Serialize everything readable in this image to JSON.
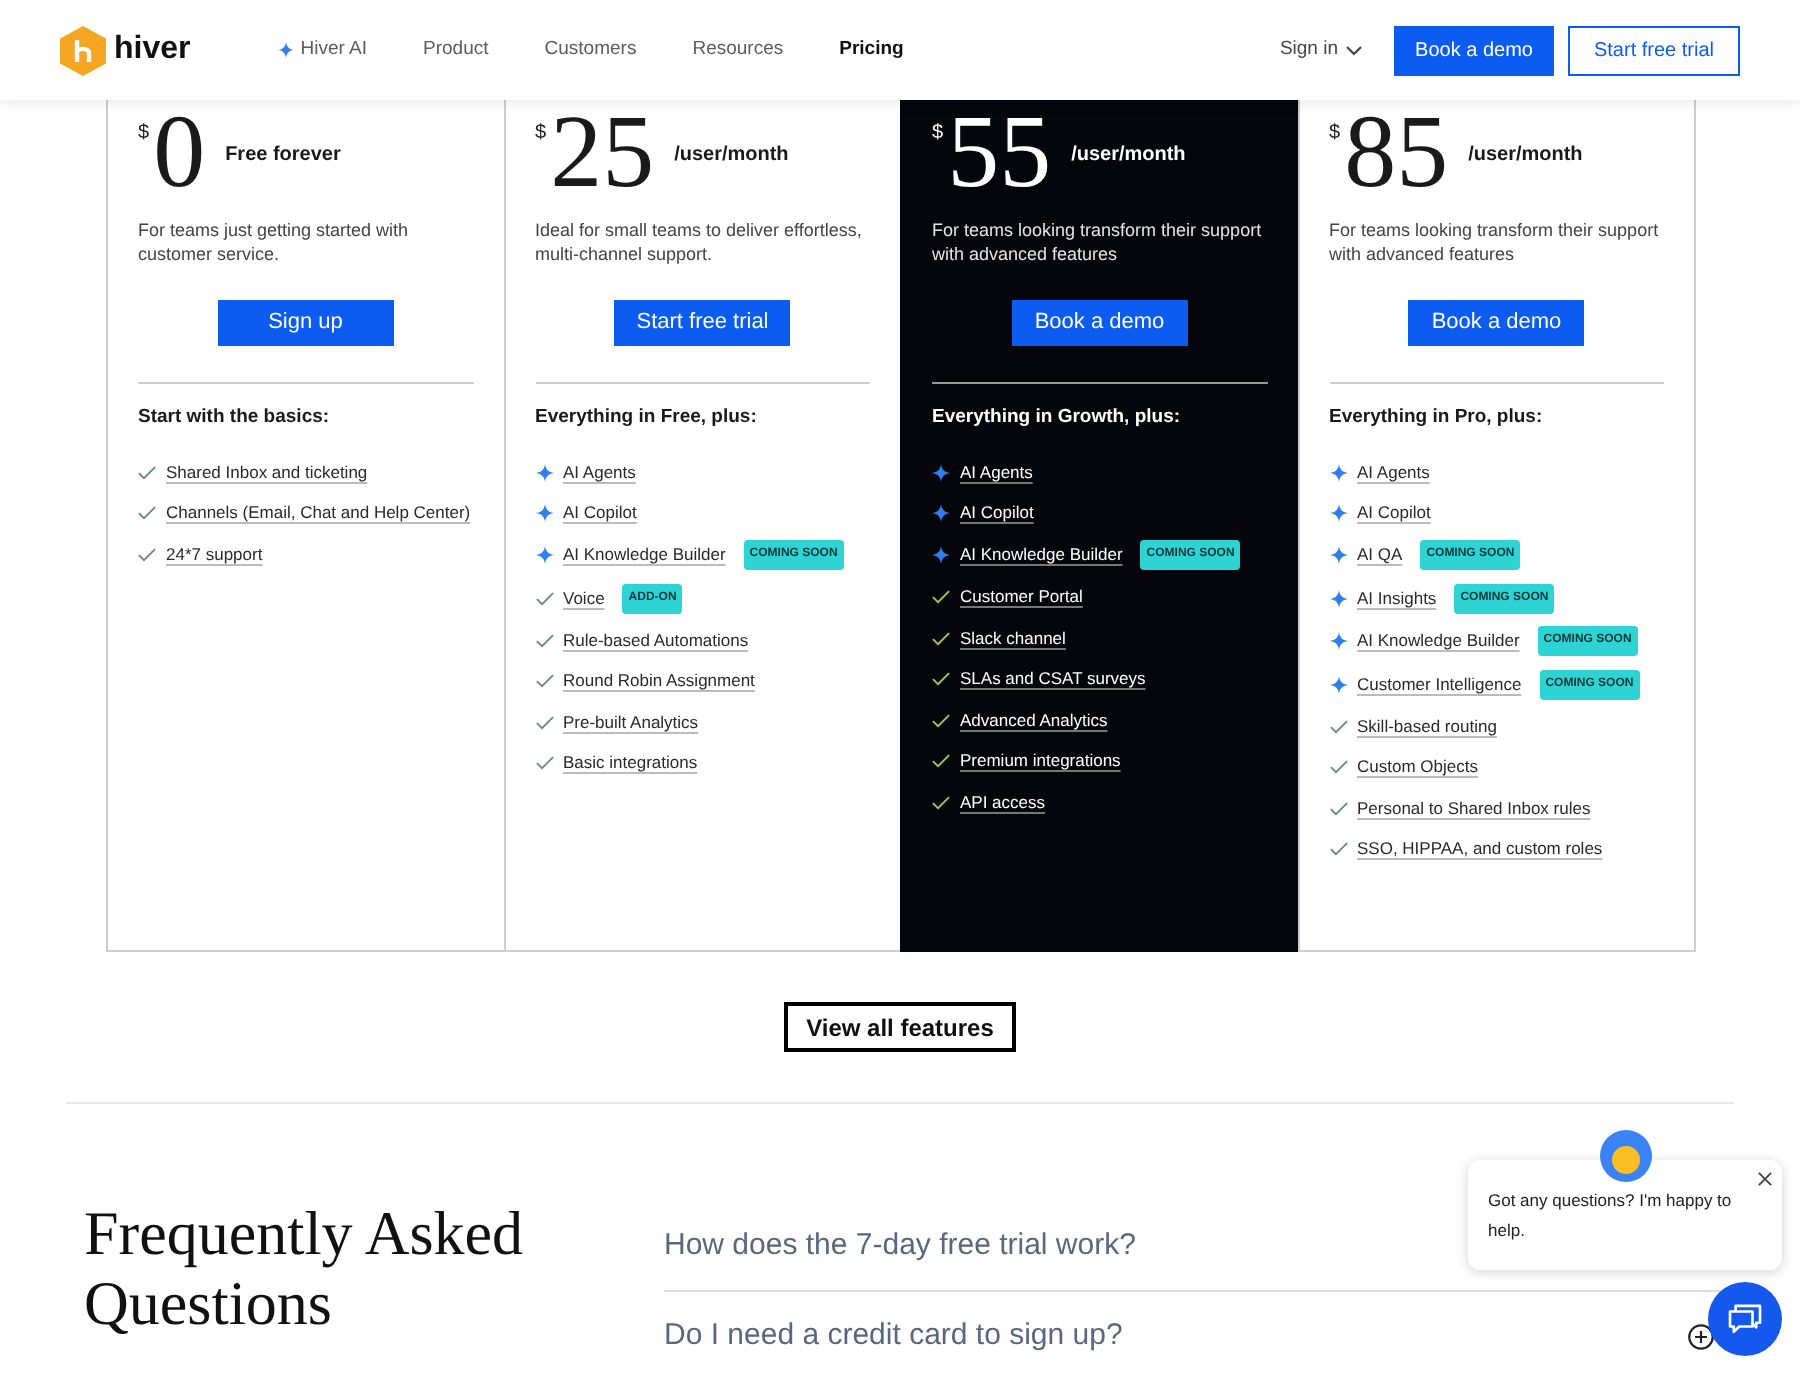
{
  "header": {
    "logo": "hiver",
    "nav": [
      {
        "label": "Hiver AI",
        "kind": "ai",
        "selected": false
      },
      {
        "label": "Product",
        "kind": "plain",
        "selected": false
      },
      {
        "label": "Customers",
        "kind": "plain",
        "selected": false
      },
      {
        "label": "Resources",
        "kind": "plain",
        "selected": false
      },
      {
        "label": "Pricing",
        "kind": "plain",
        "selected": true
      }
    ],
    "sign_in": "Sign in",
    "buttons": [
      {
        "label": "Book a demo",
        "kind": "primary"
      },
      {
        "label": "Start free trial",
        "kind": "outline"
      }
    ]
  },
  "plans": [
    {
      "highlighted": false,
      "currency": "$",
      "price": "0",
      "price_note": "Free forever",
      "description": "For teams just getting started with customer service.",
      "button": "Sign up",
      "features_heading": "Start with the basics:",
      "features": [
        {
          "kind": "check",
          "label": "Shared Inbox and ticketing"
        },
        {
          "kind": "check",
          "label": "Channels (Email, Chat and Help Center)"
        },
        {
          "kind": "check",
          "label": "24*7 support"
        }
      ]
    },
    {
      "highlighted": false,
      "currency": "$",
      "price": "25",
      "price_note": "/user/month",
      "description": "Ideal for small teams to deliver effortless, multi-channel support.",
      "button": "Start free trial",
      "features_heading": "Everything in Free, plus:",
      "features": [
        {
          "kind": "ai",
          "label": "AI Agents"
        },
        {
          "kind": "ai",
          "label": "AI Copilot"
        },
        {
          "kind": "ai",
          "label": "AI Knowledge Builder",
          "badge": "COMING SOON"
        },
        {
          "kind": "check",
          "label": "Voice",
          "badge": "ADD-ON"
        },
        {
          "kind": "check",
          "label": "Rule-based Automations"
        },
        {
          "kind": "check",
          "label": "Round Robin Assignment"
        },
        {
          "kind": "check",
          "label": "Pre-built Analytics"
        },
        {
          "kind": "check",
          "label": "Basic integrations"
        }
      ]
    },
    {
      "highlighted": true,
      "currency": "$",
      "price": "55",
      "price_note": "/user/month",
      "description": "For teams looking transform their support with advanced features",
      "button": "Book a demo",
      "features_heading": "Everything in Growth, plus:",
      "features": [
        {
          "kind": "ai",
          "label": "AI Agents"
        },
        {
          "kind": "ai",
          "label": "AI Copilot"
        },
        {
          "kind": "ai",
          "label": "AI Knowledge Builder",
          "badge": "COMING SOON"
        },
        {
          "kind": "check",
          "label": "Customer Portal"
        },
        {
          "kind": "check",
          "label": "Slack channel"
        },
        {
          "kind": "check",
          "label": "SLAs and CSAT surveys"
        },
        {
          "kind": "check",
          "label": "Advanced Analytics"
        },
        {
          "kind": "check",
          "label": "Premium integrations"
        },
        {
          "kind": "check",
          "label": "API access"
        }
      ]
    },
    {
      "highlighted": false,
      "currency": "$",
      "price": "85",
      "price_note": "/user/month",
      "description": "For teams looking transform their support with advanced features",
      "button": "Book a demo",
      "features_heading": "Everything in Pro, plus:",
      "features": [
        {
          "kind": "ai",
          "label": "AI Agents"
        },
        {
          "kind": "ai",
          "label": "AI Copilot"
        },
        {
          "kind": "ai",
          "label": "AI QA",
          "badge": "COMING SOON"
        },
        {
          "kind": "ai",
          "label": "AI Insights",
          "badge": "COMING SOON"
        },
        {
          "kind": "ai",
          "label": "AI Knowledge Builder",
          "badge": "COMING SOON"
        },
        {
          "kind": "ai",
          "label": "Customer Intelligence",
          "badge": "COMING SOON"
        },
        {
          "kind": "check",
          "label": "Skill-based routing"
        },
        {
          "kind": "check",
          "label": "Custom Objects"
        },
        {
          "kind": "check",
          "label": "Personal to Shared Inbox rules"
        },
        {
          "kind": "check",
          "label": "SSO, HIPPAA, and custom roles"
        }
      ]
    }
  ],
  "view_all": "View all features",
  "faq": {
    "title": "Frequently Asked Questions",
    "questions": [
      "How does the 7-day free trial work?",
      "Do I need a credit card to sign up?"
    ]
  },
  "chat": {
    "message": "Got any questions? I'm happy to help."
  }
}
